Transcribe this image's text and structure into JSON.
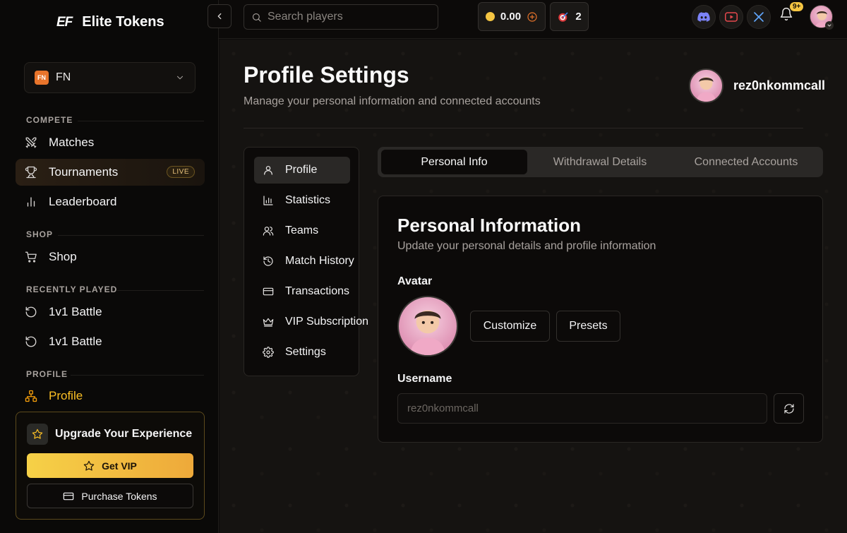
{
  "brand": {
    "mark": "EF",
    "name": "Elite Tokens"
  },
  "game_selector": {
    "badge": "FN",
    "name": "FN"
  },
  "sidebar": {
    "sections": {
      "compete": "COMPETE",
      "shop": "SHOP",
      "recently_played": "RECENTLY PLAYED",
      "profile": "PROFILE"
    },
    "items": {
      "matches": "Matches",
      "tournaments": "Tournaments",
      "tournaments_badge": "LIVE",
      "leaderboard": "Leaderboard",
      "shop": "Shop",
      "recent_1": "1v1 Battle",
      "recent_2": "1v1 Battle",
      "profile": "Profile"
    },
    "upgrade": {
      "title": "Upgrade Your Experience",
      "vip_button": "Get VIP",
      "tokens_button": "Purchase Tokens"
    }
  },
  "topbar": {
    "search_placeholder": "Search players",
    "balance": "0.00",
    "tickets": "2",
    "notifications_badge": "9+"
  },
  "page": {
    "title": "Profile Settings",
    "subtitle": "Manage your personal information and connected accounts",
    "username": "rez0nkommcall"
  },
  "settings_menu": {
    "profile": "Profile",
    "statistics": "Statistics",
    "teams": "Teams",
    "match_history": "Match History",
    "transactions": "Transactions",
    "vip_subscription": "VIP Subscription",
    "settings": "Settings"
  },
  "tabs": {
    "personal_info": "Personal Info",
    "withdrawal": "Withdrawal Details",
    "connected": "Connected Accounts"
  },
  "personal_info": {
    "title": "Personal Information",
    "subtitle": "Update your personal details and profile information",
    "avatar_label": "Avatar",
    "customize_button": "Customize",
    "presets_button": "Presets",
    "username_label": "Username",
    "username_value": "rez0nkommcall"
  },
  "colors": {
    "accent_gold": "#f5c542",
    "accent_orange": "#e8742b",
    "background": "#0c0a09"
  },
  "icons": [
    "swords-icon",
    "trophy-icon",
    "bar-chart-icon",
    "cart-icon",
    "history-icon",
    "network-icon",
    "star-icon",
    "card-icon",
    "search-icon",
    "chevron-left-icon",
    "coin-icon",
    "plus-circle-icon",
    "target-icon",
    "discord-icon",
    "youtube-icon",
    "x-icon",
    "bell-icon",
    "user-icon",
    "users-icon",
    "crown-icon",
    "gear-icon",
    "refresh-icon"
  ]
}
